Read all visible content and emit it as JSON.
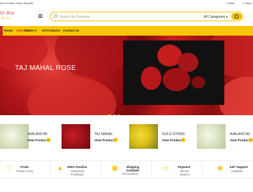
{
  "topbar": {
    "welcome": "me to Fresh Green Exports",
    "shop": "Shop",
    "my_account": "My A"
  },
  "logo": {
    "line1": "Gr Ros",
    "line2": "ferex"
  },
  "search": {
    "placeholder": "Search for Products",
    "category": "All Categories",
    "icon": "search-icon"
  },
  "nav": {
    "items": [
      "Home",
      "About Us",
      "Roses",
      "All Products",
      "Contact us"
    ]
  },
  "hero": {
    "title": "TAJ MAHAL ROSE",
    "slides": 3,
    "active_slide": 1
  },
  "products": [
    {
      "name": "AVALANCHE",
      "cta": "View Product",
      "color": "#e9eed8"
    },
    {
      "name": "TAJ MAHAL",
      "cta": "View Product",
      "color": "#b0141a"
    },
    {
      "name": "GOLD STRIKE",
      "cta": "View Product",
      "color": "#e6cc1c"
    },
    {
      "name": "AVALANCHE",
      "cta": "View Product",
      "color": "#e9eed8"
    }
  ],
  "features": [
    {
      "title": "Fresh",
      "sub": "Flowers Only",
      "icon": "heart-icon"
    },
    {
      "title": "100% Positive",
      "sub": "Customers Feedback",
      "icon": "thumbs-up-icon"
    },
    {
      "title": "Shipping Available",
      "sub": "All Countries",
      "icon": "truck-icon"
    },
    {
      "title": "Payment",
      "sub": "Secure System",
      "icon": "card-icon"
    },
    {
      "title": "24/7 Support",
      "sub": "Available",
      "icon": "headset-icon"
    }
  ]
}
